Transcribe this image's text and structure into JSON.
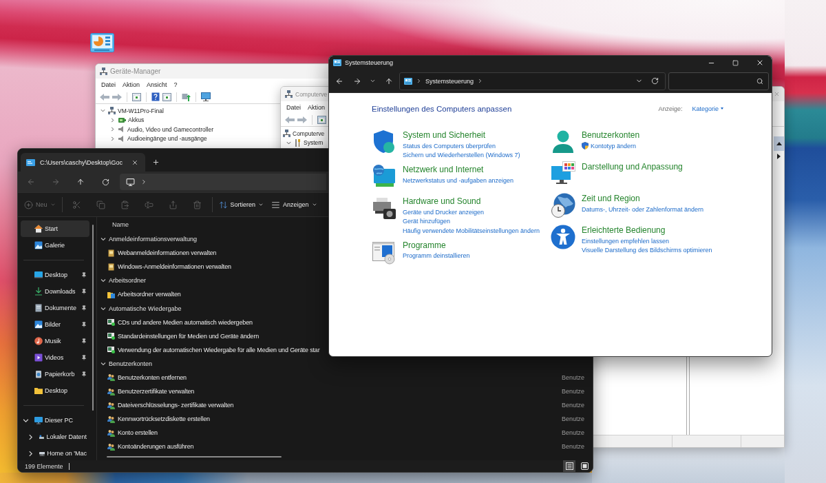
{
  "device_manager": {
    "title": "Geräte-Manager",
    "menu": [
      "Datei",
      "Aktion",
      "Ansicht",
      "?"
    ],
    "tree": [
      {
        "label": "VM-W11Pro-Final",
        "kind": "computer",
        "expanded": true,
        "children": [
          {
            "label": "Akkus",
            "kind": "battery",
            "expanded": false
          },
          {
            "label": "Audio, Video und Gamecontroller",
            "kind": "audio",
            "expanded": false
          },
          {
            "label": "Audioeingänge und -ausgänge",
            "kind": "audio",
            "expanded": false
          }
        ]
      }
    ]
  },
  "computer_management": {
    "title": "Computerve",
    "menu": [
      "Datei",
      "Aktion"
    ],
    "tree": [
      {
        "label": "Computerve",
        "kind": "computer",
        "children": [
          {
            "label": "System",
            "kind": "tools",
            "expanded": true
          }
        ]
      }
    ]
  },
  "file_explorer": {
    "tabs": [
      {
        "title": "C:\\Users\\caschy\\Desktop\\Goc",
        "selected": true
      }
    ],
    "toolbar": [
      {
        "kind": "new",
        "label": "Neu",
        "disabled": true
      },
      {
        "kind": "cut",
        "disabled": true
      },
      {
        "kind": "copy",
        "disabled": true
      },
      {
        "kind": "paste",
        "disabled": true
      },
      {
        "kind": "rename",
        "disabled": true
      },
      {
        "kind": "share",
        "disabled": true
      },
      {
        "kind": "delete",
        "disabled": true
      },
      {
        "kind": "sort",
        "label": "Sortieren",
        "disabled": false
      },
      {
        "kind": "view",
        "label": "Anzeigen",
        "disabled": false
      }
    ],
    "sidebar": {
      "sections": [
        {
          "items": [
            {
              "kind": "home",
              "label": "Start",
              "selected": true
            },
            {
              "kind": "gallery",
              "label": "Galerie",
              "selected": false
            }
          ]
        },
        {
          "items": [
            {
              "kind": "desktop",
              "label": "Desktop",
              "pinned": true,
              "selected": false
            },
            {
              "kind": "downloads",
              "label": "Downloads",
              "pinned": true,
              "selected": false
            },
            {
              "kind": "documents",
              "label": "Dokumente",
              "pinned": true,
              "selected": false
            },
            {
              "kind": "pictures",
              "label": "Bilder",
              "pinned": true,
              "selected": false
            },
            {
              "kind": "music",
              "label": "Musik",
              "pinned": true,
              "selected": false
            },
            {
              "kind": "videos",
              "label": "Videos",
              "pinned": true,
              "selected": false
            },
            {
              "kind": "recycle",
              "label": "Papierkorb",
              "pinned": true,
              "selected": false
            },
            {
              "kind": "folder",
              "label": "Desktop",
              "pinned": false,
              "selected": false
            }
          ]
        },
        {
          "items": [
            {
              "kind": "pc",
              "label": "Dieser PC",
              "selected": false,
              "expanded": true,
              "children": [
                {
                  "kind": "drive",
                  "label": "Lokaler Datent",
                  "selected": false,
                  "expanded": false
                },
                {
                  "kind": "netdrive",
                  "label": "Home on 'Mac",
                  "selected": false,
                  "expanded": false
                }
              ]
            }
          ]
        }
      ]
    },
    "columns": [
      {
        "label": "Name"
      }
    ],
    "groups": [
      {
        "title": "Anmeldeinformationsverwaltung",
        "expanded": true,
        "items": [
          {
            "kind": "vault",
            "name": "Webanmeldeinformationen verwalten"
          },
          {
            "kind": "vault",
            "name": "Windows-Anmeldeinformationen verwalten"
          }
        ]
      },
      {
        "title": "Arbeitsordner",
        "expanded": true,
        "items": [
          {
            "kind": "workfolders",
            "name": "Arbeitsordner verwalten"
          }
        ]
      },
      {
        "title": "Automatische Wiedergabe",
        "expanded": true,
        "items": [
          {
            "kind": "autoplay",
            "name": "CDs und andere Medien automatisch wiedergeben"
          },
          {
            "kind": "autoplay",
            "name": "Standardeinstellungen für Medien und Geräte ändern"
          },
          {
            "kind": "autoplay",
            "name": "Verwendung der automatischen Wiedergabe für alle Medien und Geräte star"
          }
        ]
      },
      {
        "title": "Benutzerkonten",
        "expanded": true,
        "items": [
          {
            "kind": "users",
            "name": "Benutzerkonten entfernen",
            "column_2": "Benutze"
          },
          {
            "kind": "users",
            "name": "Benutzerzertifikate verwalten",
            "column_2": "Benutze"
          },
          {
            "kind": "users",
            "name": "Dateiverschlüsselungs- zertifikate verwalten",
            "column_2": "Benutze"
          },
          {
            "kind": "users",
            "name": "Kennwortrücksetzdiskette erstellen",
            "column_2": "Benutze"
          },
          {
            "kind": "users",
            "name": "Konto erstellen",
            "column_2": "Benutze"
          },
          {
            "kind": "users",
            "name": "Kontoänderungen ausführen",
            "column_2": "Benutze"
          }
        ]
      }
    ],
    "status": {
      "count": "199 Elemente",
      "views": [
        {
          "kind": "details",
          "selected": true
        },
        {
          "kind": "tiles",
          "selected": false
        }
      ]
    }
  },
  "control_panel": {
    "title": "Systemsteuerung",
    "breadcrumb": [
      "Systemsteuerung"
    ],
    "heading": "Einstellungen des Computers anpassen",
    "view_label": "Anzeige:",
    "view_value": "Kategorie",
    "columns": [
      [
        {
          "kind": "security",
          "title": "System und Sicherheit",
          "links": [
            {
              "text": "Status des Computers überprüfen",
              "shield": false
            },
            {
              "text": "Sichern und Wiederherstellen (Windows 7)",
              "shield": false
            }
          ]
        },
        {
          "kind": "network",
          "title": "Netzwerk und Internet",
          "links": [
            {
              "text": "Netzwerkstatus und -aufgaben anzeigen",
              "shield": false
            }
          ]
        },
        {
          "kind": "hardware",
          "title": "Hardware und Sound",
          "links": [
            {
              "text": "Geräte und Drucker anzeigen",
              "shield": false
            },
            {
              "text": "Gerät hinzufügen",
              "shield": false
            },
            {
              "text": "Häufig verwendete Mobilitätseinstellungen ändern",
              "shield": false
            }
          ]
        },
        {
          "kind": "programs",
          "title": "Programme",
          "links": [
            {
              "text": "Programm deinstallieren",
              "shield": false
            }
          ]
        }
      ],
      [
        {
          "kind": "users",
          "title": "Benutzerkonten",
          "links": [
            {
              "text": "Kontotyp ändern",
              "shield": true
            }
          ]
        },
        {
          "kind": "appearance",
          "title": "Darstellung und Anpassung"
        },
        {
          "kind": "clock",
          "title": "Zeit und Region",
          "links": [
            {
              "text": "Datums-, Uhrzeit- oder Zahlenformat ändern",
              "shield": false
            }
          ]
        },
        {
          "kind": "access",
          "title": "Erleichterte Bedienung",
          "links": [
            {
              "text": "Einstellungen empfehlen lassen",
              "shield": false
            },
            {
              "text": "Visuelle Darstellung des Bildschirms optimieren",
              "shield": false
            }
          ]
        }
      ]
    ]
  }
}
